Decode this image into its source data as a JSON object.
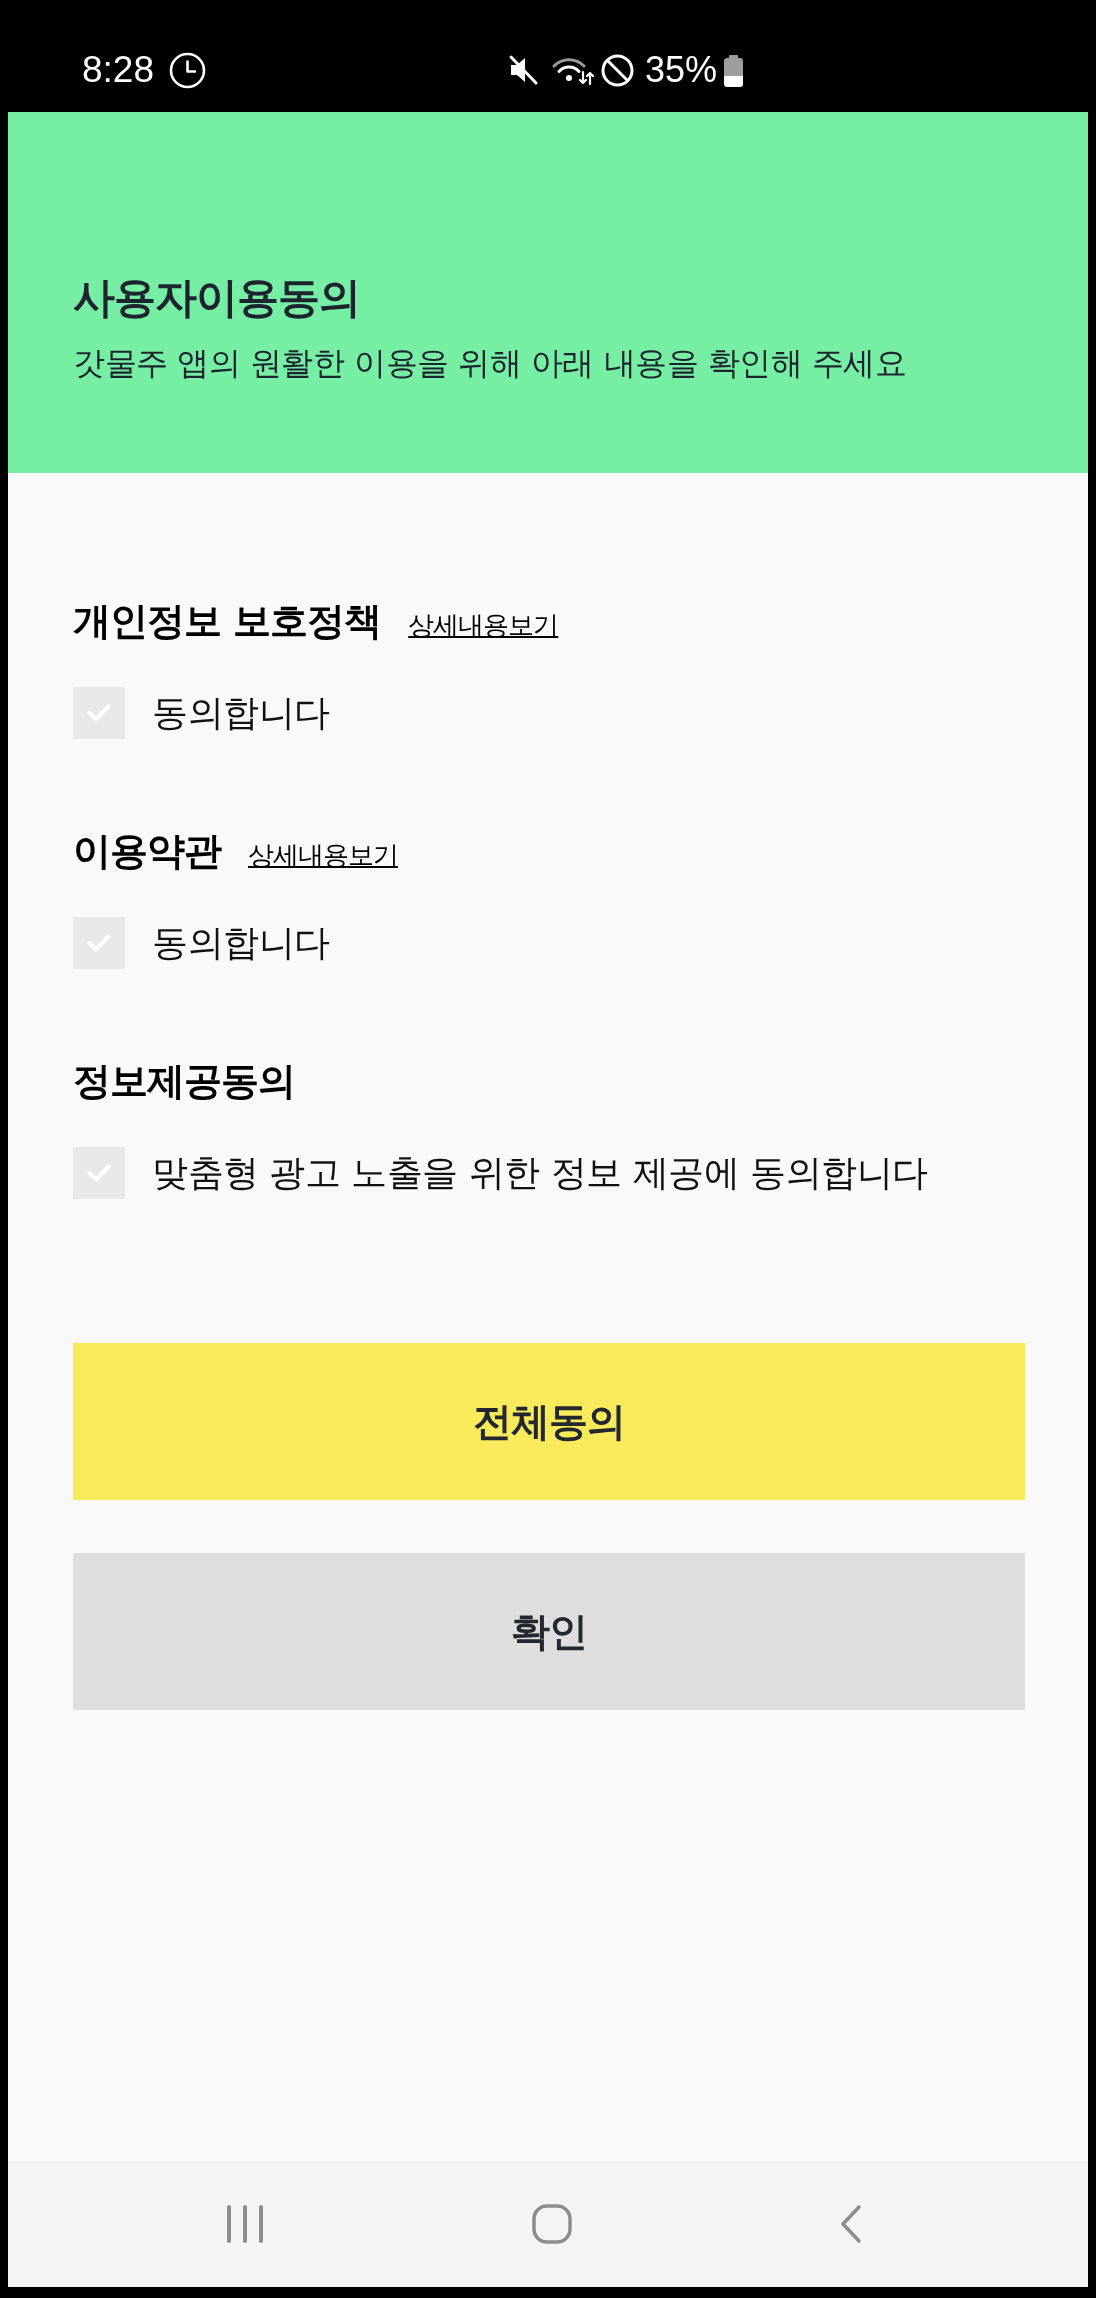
{
  "status_bar": {
    "time": "8:28",
    "battery": "35%"
  },
  "header": {
    "title": "사용자이용동의",
    "subtitle": "갓물주 앱의 원활한 이용을 위해 아래 내용을 확인해 주세요"
  },
  "sections": [
    {
      "title": "개인정보 보호정책",
      "link": "상세내용보기",
      "agreement": {
        "label": "동의합니다",
        "checked": false
      }
    },
    {
      "title": "이용약관",
      "link": "상세내용보기",
      "agreement": {
        "label": "동의합니다",
        "checked": false
      }
    },
    {
      "title": "정보제공동의",
      "agreement": {
        "label": "맞춤형 광고 노출을 위한 정보 제공에 동의합니다",
        "checked": false
      }
    }
  ],
  "buttons": [
    {
      "label": "전체동의",
      "kind": "primary"
    },
    {
      "label": "확인",
      "kind": "secondary"
    }
  ]
}
